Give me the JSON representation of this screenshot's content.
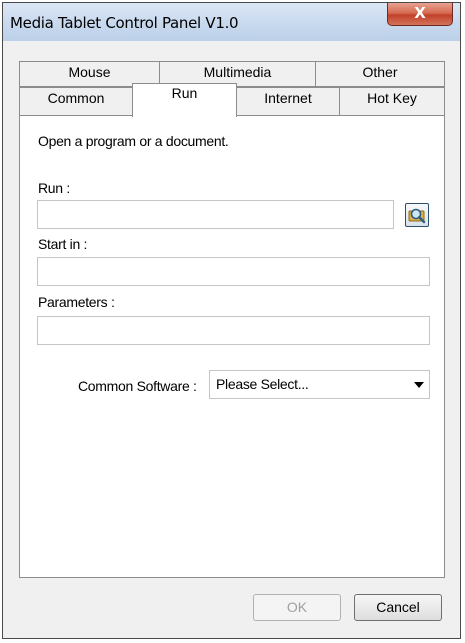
{
  "window": {
    "title": "Media Tablet Control Panel V1.0",
    "close_label": "X"
  },
  "tabs_row1": [
    {
      "label": "Mouse"
    },
    {
      "label": "Multimedia"
    },
    {
      "label": "Other"
    }
  ],
  "tabs_row2": [
    {
      "label": "Common"
    },
    {
      "label": "Run",
      "selected": true
    },
    {
      "label": "Internet"
    },
    {
      "label": "Hot Key"
    }
  ],
  "run_tab": {
    "description": "Open a program or a document.",
    "run_label": "Run :",
    "run_value": "",
    "start_in_label": "Start in :",
    "start_in_value": "",
    "parameters_label": "Parameters :",
    "parameters_value": "",
    "common_software_label": "Common Software :",
    "common_software_value": "Please Select..."
  },
  "buttons": {
    "ok": "OK",
    "ok_enabled": false,
    "cancel": "Cancel"
  },
  "icons": {
    "browse": "magnifier-folder-icon",
    "close": "close-icon",
    "dropdown": "chevron-down-icon"
  }
}
